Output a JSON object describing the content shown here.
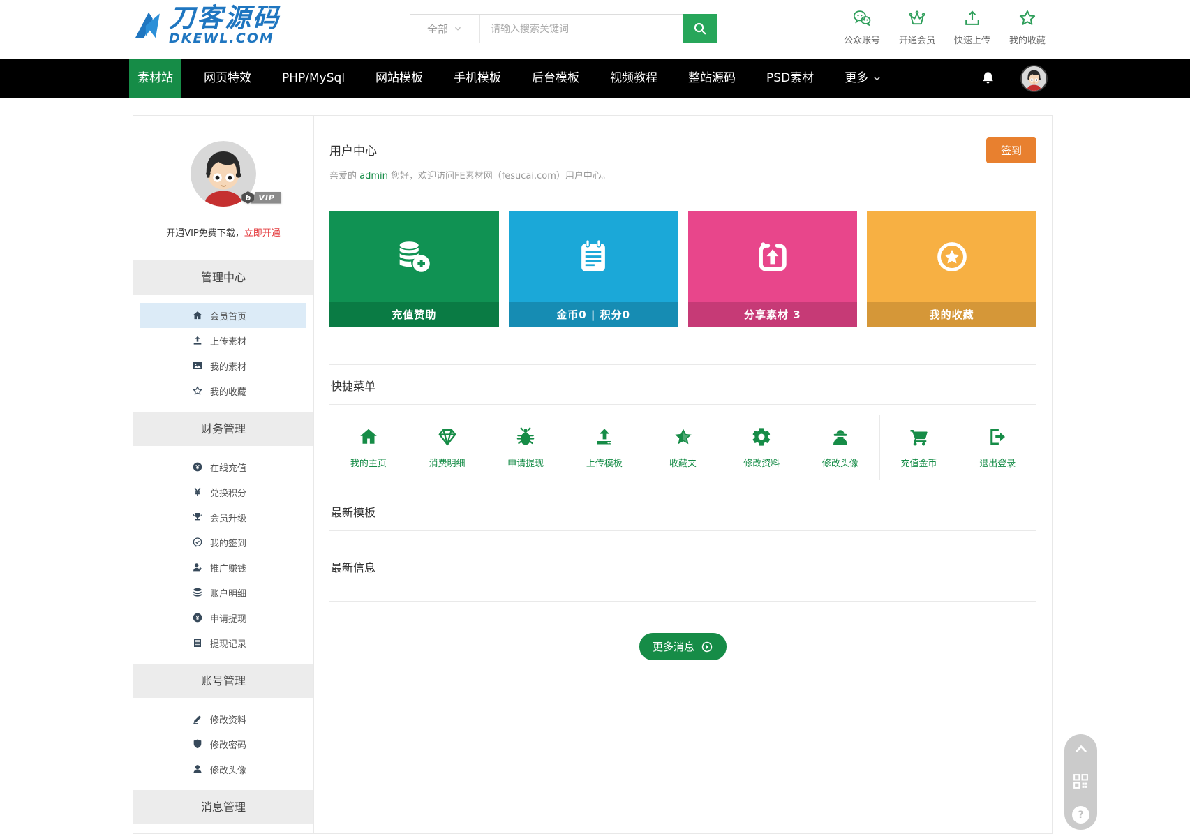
{
  "colors": {
    "accent_green": "#168c47",
    "search_green": "#27a65a",
    "signin_orange": "#e8802f",
    "vip_red": "#e4393c",
    "active_row_blue": "#dcebf7",
    "card_green": "#109253",
    "card_cyan": "#1ba8d8",
    "card_pink": "#e8468b",
    "card_amber": "#f7b043"
  },
  "header": {
    "logo": {
      "title": "刀客源码",
      "subtitle": "DKEWL.COM"
    },
    "search": {
      "category": "全部",
      "placeholder": "请输入搜索关键词"
    },
    "quick_links": [
      {
        "label": "公众账号",
        "icon": "wechat-icon"
      },
      {
        "label": "开通会员",
        "icon": "crown-icon"
      },
      {
        "label": "快速上传",
        "icon": "upload-icon"
      },
      {
        "label": "我的收藏",
        "icon": "star-icon"
      }
    ]
  },
  "navbar": {
    "items": [
      {
        "label": "素材站",
        "active": true
      },
      {
        "label": "网页特效"
      },
      {
        "label": "PHP/MySql"
      },
      {
        "label": "网站模板"
      },
      {
        "label": "手机模板"
      },
      {
        "label": "后台模板"
      },
      {
        "label": "视频教程"
      },
      {
        "label": "整站源码"
      },
      {
        "label": "PSD素材"
      },
      {
        "label": "更多"
      }
    ]
  },
  "sidebar": {
    "vip": {
      "badge_mark": "b",
      "badge": "VIP",
      "text": "开通VIP免费下载，",
      "link": "立即开通"
    },
    "sections": [
      {
        "title": "管理中心",
        "items": [
          {
            "label": "会员首页",
            "icon": "home-icon",
            "active": true
          },
          {
            "label": "上传素材",
            "icon": "upload-icon"
          },
          {
            "label": "我的素材",
            "icon": "image-icon"
          },
          {
            "label": "我的收藏",
            "icon": "star-icon"
          }
        ]
      },
      {
        "title": "财务管理",
        "items": [
          {
            "label": "在线充值",
            "icon": "yen-circle-icon"
          },
          {
            "label": "兑换积分",
            "icon": "yen-exchange-icon"
          },
          {
            "label": "会员升级",
            "icon": "trophy-icon"
          },
          {
            "label": "我的签到",
            "icon": "check-circle-icon"
          },
          {
            "label": "推广赚钱",
            "icon": "user-plus-icon"
          },
          {
            "label": "账户明细",
            "icon": "coins-icon"
          },
          {
            "label": "申请提现",
            "icon": "yen-circle-icon"
          },
          {
            "label": "提现记录",
            "icon": "document-icon"
          }
        ]
      },
      {
        "title": "账号管理",
        "items": [
          {
            "label": "修改资料",
            "icon": "pencil-icon"
          },
          {
            "label": "修改密码",
            "icon": "shield-icon"
          },
          {
            "label": "修改头像",
            "icon": "user-icon"
          }
        ]
      },
      {
        "title": "消息管理",
        "items": []
      }
    ]
  },
  "main": {
    "title": "用户中心",
    "signin_button": "签到",
    "greeting": {
      "prefix": "亲爱的 ",
      "username": "admin",
      "suffix": " 您好，欢迎访问FE素材网（fesucai.com）用户中心。"
    },
    "stat_cards": [
      {
        "label": "充值赞助",
        "icon": "coins-plus-icon",
        "bg": "#109253",
        "bar": "#0a7b44"
      },
      {
        "label": "金币0 | 积分0",
        "icon": "notepad-icon",
        "bg": "#1ba8d8",
        "bar": "#168cb3"
      },
      {
        "label": "分享素材 3",
        "icon": "share-upload-icon",
        "bg": "#e8468b",
        "bar": "#c63a76"
      },
      {
        "label": "我的收藏",
        "icon": "star-circle-icon",
        "bg": "#f7b043",
        "bar": "#d59738"
      }
    ],
    "quick_menu": {
      "title": "快捷菜单",
      "items": [
        {
          "label": "我的主页",
          "icon": "home-icon"
        },
        {
          "label": "消费明细",
          "icon": "diamond-icon"
        },
        {
          "label": "申请提现",
          "icon": "bug-icon"
        },
        {
          "label": "上传模板",
          "icon": "upload-icon"
        },
        {
          "label": "收藏夹",
          "icon": "star-icon"
        },
        {
          "label": "修改资料",
          "icon": "gear-icon"
        },
        {
          "label": "修改头像",
          "icon": "spy-icon"
        },
        {
          "label": "充值金币",
          "icon": "cart-icon"
        },
        {
          "label": "退出登录",
          "icon": "logout-icon"
        }
      ]
    },
    "list_sections": [
      {
        "title": "最新模板"
      },
      {
        "title": "最新信息"
      }
    ],
    "more_button": {
      "label": "更多消息",
      "icon": "arrow-right-circle-icon"
    }
  },
  "floating": {
    "items": [
      {
        "name": "back-to-top",
        "icon": "chevron-up-icon"
      },
      {
        "name": "qr-code",
        "icon": "qr-code-icon"
      },
      {
        "name": "help",
        "icon": "help-icon",
        "label": "?"
      }
    ]
  }
}
